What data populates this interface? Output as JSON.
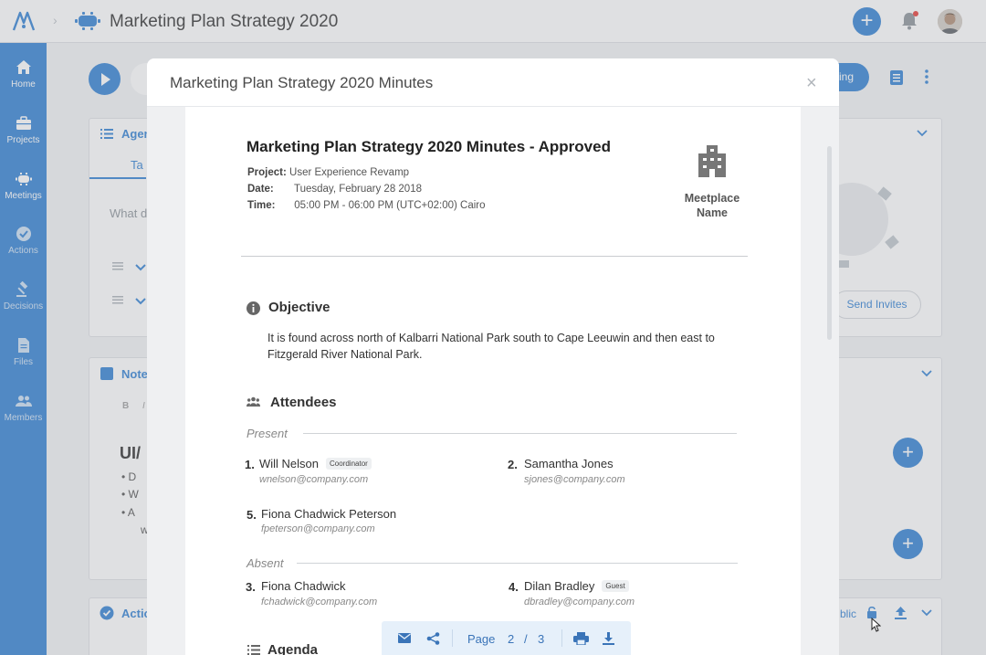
{
  "topbar": {
    "title": "Marketing Plan Strategy 2020",
    "add_label": "+"
  },
  "sidebar": {
    "items": [
      {
        "label": "Home",
        "icon": "home-icon"
      },
      {
        "label": "Projects",
        "icon": "briefcase-icon"
      },
      {
        "label": "Meetings",
        "icon": "meeting-icon"
      },
      {
        "label": "Actions",
        "icon": "check-circle-icon"
      },
      {
        "label": "Decisions",
        "icon": "gavel-icon"
      },
      {
        "label": "Files",
        "icon": "file-icon"
      },
      {
        "label": "Members",
        "icon": "members-icon"
      }
    ]
  },
  "background": {
    "pill_right": "ing",
    "agenda_title": "Agen",
    "agenda_tab": "Ta",
    "agenda_placeholder": "What d",
    "send_invites": "Send Invites",
    "notes_title": "Note",
    "notes_toolbar_b": "B",
    "notes_toolbar_i": "I",
    "notes_heading": "UI/",
    "notes_bullets": [
      "D",
      "W",
      "A",
      "w"
    ],
    "actions_title": "Actio",
    "public_label": "blic",
    "plus": "+"
  },
  "modal": {
    "title": "Marketing Plan Strategy 2020 Minutes",
    "close": "×",
    "doc": {
      "title": "Marketing Plan Strategy 2020 Minutes - Approved",
      "project_label": "Project:",
      "project": "User Experience Revamp",
      "date_label": "Date:",
      "date": "Tuesday, February 28 2018",
      "time_label": "Time:",
      "time": "05:00 PM - 06:00 PM (UTC+02:00) Cairo",
      "place_line1": "Meetplace",
      "place_line2": "Name",
      "objective_title": "Objective",
      "objective_text": "It is found across north of Kalbarri National Park south to Cape Leeuwin and then east to Fitzgerald River National Park.",
      "attendees_title": "Attendees",
      "present_label": "Present",
      "absent_label": "Absent",
      "present": [
        {
          "num": "1.",
          "name": "Will Nelson",
          "badge": "Coordinator",
          "email": "wnelson@company.com"
        },
        {
          "num": "2.",
          "name": "Samantha Jones",
          "badge": "",
          "email": "sjones@company.com"
        },
        {
          "num": "5.",
          "name": "Fiona Chadwick Peterson",
          "badge": "",
          "email": "fpeterson@company.com"
        }
      ],
      "absent": [
        {
          "num": "3.",
          "name": "Fiona Chadwick",
          "badge": "",
          "email": "fchadwick@company.com"
        },
        {
          "num": "4.",
          "name": "Dilan Bradley",
          "badge": "Guest",
          "email": "dbradley@company.com"
        }
      ],
      "agenda_title": "Agenda"
    }
  },
  "pagebar": {
    "page_label": "Page",
    "current_page": "2",
    "separator": "/",
    "total_pages": "3"
  },
  "colors": {
    "accent": "#4a90d9",
    "sidebar": "#4a90d9",
    "notification_dot": "#e9534f"
  }
}
